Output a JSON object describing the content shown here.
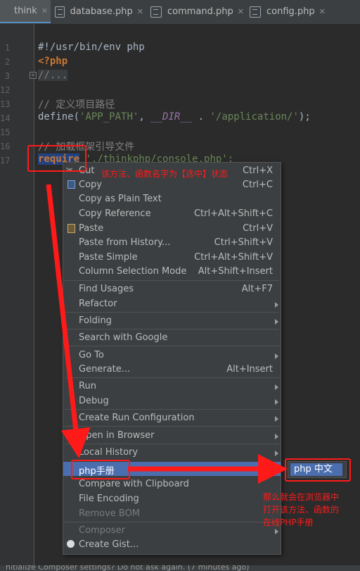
{
  "tabs": [
    {
      "label": "think",
      "active": true
    },
    {
      "label": "database.php"
    },
    {
      "label": "command.php"
    },
    {
      "label": "config.php"
    }
  ],
  "gutter": {
    "line_numbers": [
      "1",
      "2",
      "3",
      "12",
      "13",
      "14",
      "15",
      "16",
      "17"
    ]
  },
  "editor": {
    "line1": "#!/usr/bin/env php",
    "line2": "<?php",
    "line3": "//...",
    "line13_comment": "// 定义项目路径",
    "line14_fn": "define(",
    "line14_s1": "'APP_PATH'",
    "line14_sep": ", ",
    "line14_const": "__DIR__",
    "line14_dot": " . ",
    "line14_s2": "'/application/'",
    "line14_end": ");",
    "line16_comment": "// 加载框架引导文件",
    "line17_kw": "require",
    "line17_rest": " './thinkphp/console.php';"
  },
  "menu": {
    "items": [
      {
        "label": "Cut",
        "shortcut": "Ctrl+X"
      },
      {
        "label": "Copy",
        "shortcut": "Ctrl+C"
      },
      {
        "label": "Copy as Plain Text",
        "shortcut": ""
      },
      {
        "label": "Copy Reference",
        "shortcut": "Ctrl+Alt+Shift+C"
      },
      {
        "label": "Paste",
        "shortcut": "Ctrl+V"
      },
      {
        "label": "Paste from History...",
        "shortcut": "Ctrl+Shift+V"
      },
      {
        "label": "Paste Simple",
        "shortcut": "Ctrl+Alt+Shift+V"
      },
      {
        "label": "Column Selection Mode",
        "shortcut": "Alt+Shift+Insert"
      },
      {
        "label": "Find Usages",
        "shortcut": "Alt+F7"
      },
      {
        "label": "Refactor",
        "shortcut": ""
      },
      {
        "label": "Folding",
        "shortcut": ""
      },
      {
        "label": "Search with Google",
        "shortcut": ""
      },
      {
        "label": "Go To",
        "shortcut": ""
      },
      {
        "label": "Generate...",
        "shortcut": "Alt+Insert"
      },
      {
        "label": "Run",
        "shortcut": ""
      },
      {
        "label": "Debug",
        "shortcut": ""
      },
      {
        "label": "Create Run Configuration",
        "shortcut": ""
      },
      {
        "label": "Open in Browser",
        "shortcut": ""
      },
      {
        "label": "Local History",
        "shortcut": ""
      },
      {
        "label": "php手册",
        "shortcut": ""
      },
      {
        "label": "Compare with Clipboard",
        "shortcut": ""
      },
      {
        "label": "File Encoding",
        "shortcut": ""
      },
      {
        "label": "Remove BOM",
        "shortcut": ""
      },
      {
        "label": "Composer",
        "shortcut": ""
      },
      {
        "label": "Create Gist...",
        "shortcut": ""
      }
    ]
  },
  "submenu": {
    "label": "php 中文"
  },
  "annotations": {
    "top": "该方法、函数名字为【选中】状态",
    "right": [
      "那么就会在浏览器中",
      "打开该方法、函数的",
      "在线PHP手册"
    ]
  },
  "status": {
    "text": "nitialize Composer settings? Do not ask again. (7 minutes ago)"
  },
  "colors": {
    "annotation": "#ff1a1a",
    "highlight": "#4b6eaf",
    "selection": "#214283"
  },
  "icons": [
    "file-php-icon",
    "copy-icon",
    "paste-icon",
    "globe-icon",
    "github-icon"
  ]
}
